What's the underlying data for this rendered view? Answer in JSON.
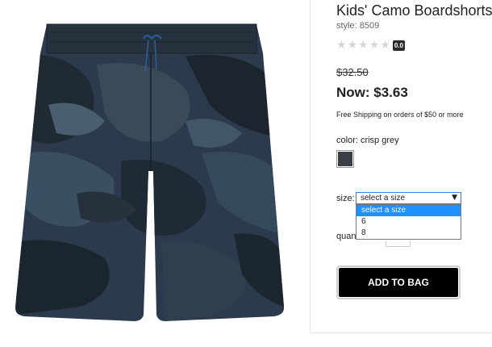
{
  "product": {
    "title": "Kids' Camo Boardshorts",
    "style_line": "style: 8509",
    "image_label": "shorts-product-image"
  },
  "rating": {
    "stars_total": 5,
    "stars_filled": 0,
    "value": "0.0"
  },
  "pricing": {
    "was_price": "$32.50",
    "now_price": "Now: $3.63",
    "shipping_note": "Free Shipping on orders of $50 or more"
  },
  "color": {
    "label": "color: crisp grey",
    "swatch_hex": "#3a4046"
  },
  "size": {
    "label": "size:",
    "selected": "select a size",
    "options": [
      "select a size",
      "6",
      "8"
    ]
  },
  "quantity": {
    "label": "quan"
  },
  "actions": {
    "add_to_bag": "ADD TO BAG"
  },
  "colors": {
    "accent_blue": "#1e90ff",
    "button_black": "#000000"
  }
}
